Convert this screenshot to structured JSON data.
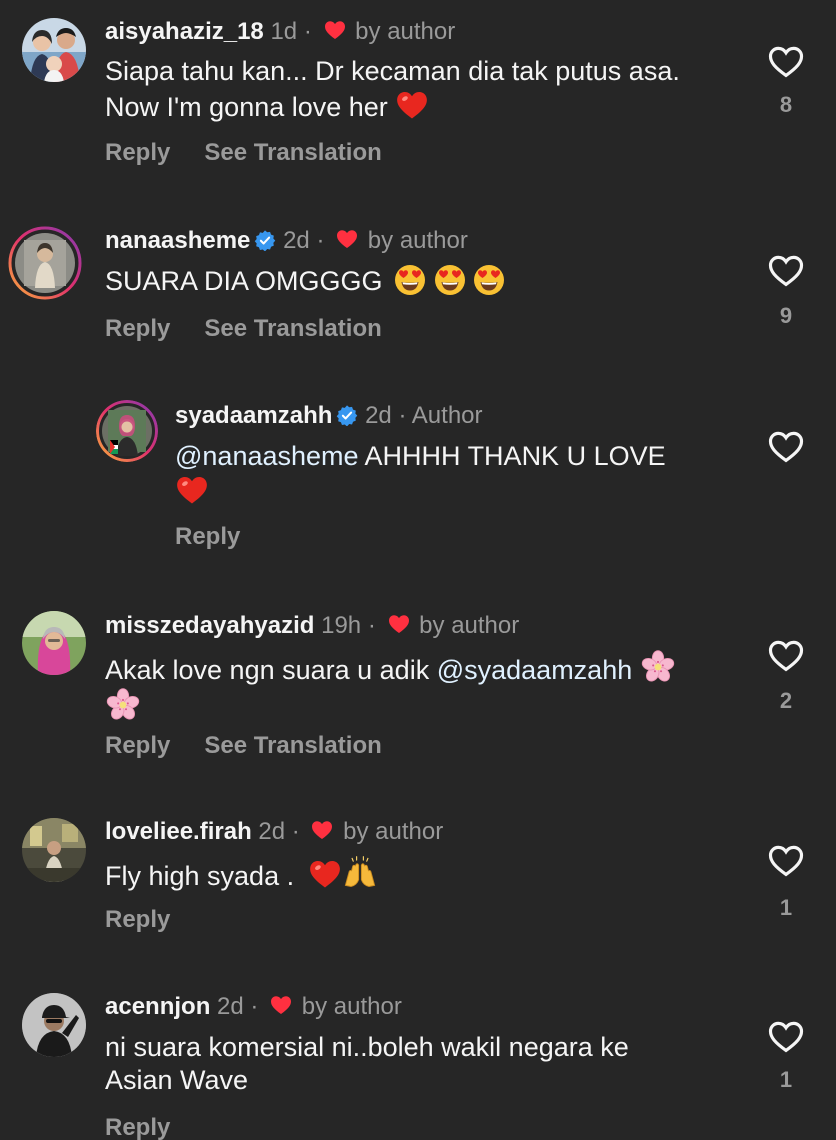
{
  "comments": [
    {
      "username": "aisyahaziz_18",
      "time": "1d",
      "sep": "·",
      "liked_label": "by author",
      "text_line1": "Siapa tahu kan... Dr kecaman dia tak putus asa.",
      "text_line2": "Now I'm gonna love her",
      "reply_label": "Reply",
      "translate_label": "See Translation",
      "likes": "8",
      "avatar_icon": "couple-photo-icon"
    },
    {
      "username": "nanaasheme",
      "time": "2d",
      "sep": "·",
      "liked_label": "by author",
      "text_line1": "SUARA DIA OMGGGG",
      "reply_label": "Reply",
      "translate_label": "See Translation",
      "likes": "9",
      "verified": true,
      "avatar_icon": "story-ring-avatar-icon"
    },
    {
      "username": "syadaamzahh",
      "time": "2d",
      "sep": "·",
      "author_label": "Author",
      "mention": "@nanaasheme",
      "text_line1": "AHHHH THANK U LOVE",
      "reply_label": "Reply",
      "verified": true,
      "avatar_icon": "story-ring-avatar-icon"
    },
    {
      "username": "misszedayahyazid",
      "time": "19h",
      "sep": "·",
      "liked_label": "by author",
      "text_line1": "Akak love ngn suara u adik",
      "mention": "@syadaamzahh",
      "reply_label": "Reply",
      "translate_label": "See Translation",
      "likes": "2",
      "avatar_icon": "hijab-portrait-icon"
    },
    {
      "username": "loveliee.firah",
      "time": "2d",
      "sep": "·",
      "liked_label": "by author",
      "text_line1": "Fly high syada .",
      "reply_label": "Reply",
      "likes": "1",
      "avatar_icon": "photo-avatar-icon"
    },
    {
      "username": "acennjon",
      "time": "2d",
      "sep": "·",
      "liked_label": "by author",
      "text_line1": "ni suara komersial ni..boleh wakil negara ke",
      "text_line2": "Asian Wave",
      "reply_label": "Reply",
      "likes": "1",
      "avatar_icon": "man-cap-avatar-icon"
    }
  ],
  "colors": {
    "background": "#262626",
    "text": "#f5f5f5",
    "muted": "#9a9a9a",
    "mention": "#e0f1ff",
    "heart": "#ff3040",
    "verified": "#3797f0"
  }
}
